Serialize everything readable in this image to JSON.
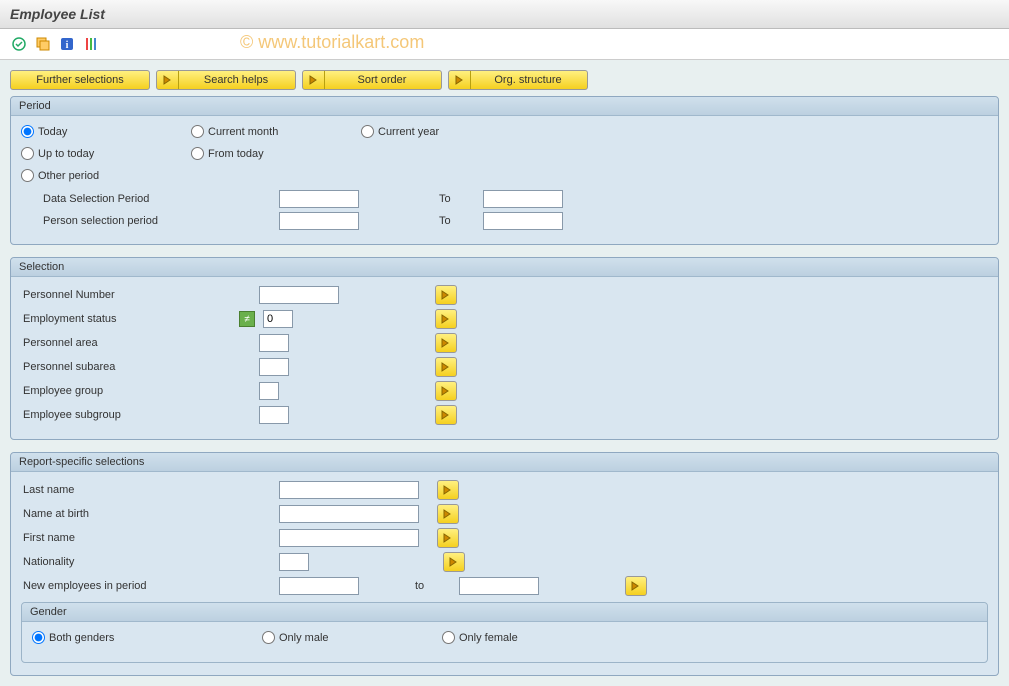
{
  "header": {
    "title": "Employee List"
  },
  "watermark": "© www.tutorialkart.com",
  "toolbar_icons": [
    "execute",
    "variant",
    "info",
    "output"
  ],
  "action_buttons": {
    "further_selections": "Further selections",
    "search_helps": "Search helps",
    "sort_order": "Sort order",
    "org_structure": "Org. structure"
  },
  "period": {
    "legend": "Period",
    "options": {
      "today": "Today",
      "current_month": "Current month",
      "current_year": "Current year",
      "up_to_today": "Up to today",
      "from_today": "From today",
      "other_period": "Other period"
    },
    "selected": "today",
    "data_sel_label": "Data Selection Period",
    "person_sel_label": "Person selection period",
    "to_label": "To",
    "data_from": "",
    "data_to": "",
    "person_from": "",
    "person_to": ""
  },
  "selection": {
    "legend": "Selection",
    "rows": {
      "personnel_number": {
        "label": "Personnel Number",
        "value": ""
      },
      "employment_status": {
        "label": "Employment status",
        "value": "0",
        "badge": "≠"
      },
      "personnel_area": {
        "label": "Personnel area",
        "value": ""
      },
      "personnel_subarea": {
        "label": "Personnel subarea",
        "value": ""
      },
      "employee_group": {
        "label": "Employee group",
        "value": ""
      },
      "employee_subgroup": {
        "label": "Employee subgroup",
        "value": ""
      }
    }
  },
  "report": {
    "legend": "Report-specific selections",
    "rows": {
      "last_name": {
        "label": "Last name",
        "value": ""
      },
      "name_at_birth": {
        "label": "Name at birth",
        "value": ""
      },
      "first_name": {
        "label": "First name",
        "value": ""
      },
      "nationality": {
        "label": "Nationality",
        "value": ""
      }
    },
    "new_employees": {
      "label": "New employees in period",
      "from": "",
      "to_label": "to",
      "to": ""
    },
    "gender": {
      "legend": "Gender",
      "options": {
        "both": "Both genders",
        "male": "Only male",
        "female": "Only female"
      },
      "selected": "both"
    }
  }
}
